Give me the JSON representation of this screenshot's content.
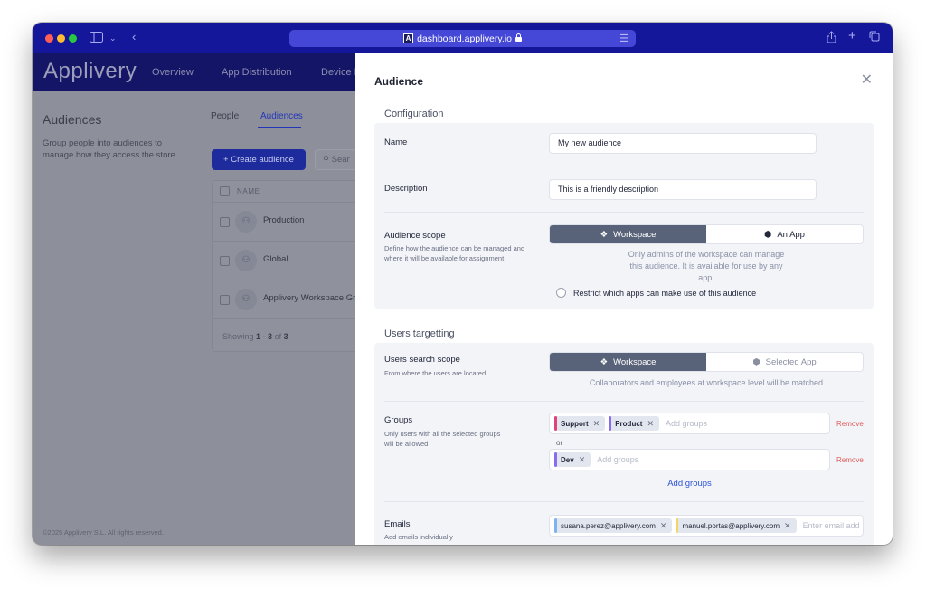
{
  "browser": {
    "url": "dashboard.applivery.io",
    "icons": [
      "sidebar-icon",
      "chevron-down-icon",
      "back-icon",
      "share-icon",
      "new-tab-icon",
      "tabs-overview-icon",
      "lock-icon",
      "reader-icon"
    ]
  },
  "appnav": {
    "brand": "Applivery",
    "links": [
      "Overview",
      "App Distribution",
      "Device M"
    ]
  },
  "page": {
    "title": "Audiences",
    "description": "Group people into audiences to manage how they access the store.",
    "tabs": [
      {
        "label": "People",
        "active": false
      },
      {
        "label": "Audiences",
        "active": true
      }
    ],
    "create_button": "+ Create audience",
    "search_placeholder": "Sear",
    "table": {
      "header": "NAME",
      "rows": [
        "Production",
        "Global",
        "Applivery Workspace Gro"
      ],
      "showing_prefix": "Showing ",
      "range_start": "1",
      "range_sep": " - ",
      "range_end": "3",
      "of": " of ",
      "total": "3"
    },
    "footer": "©2025 Applivery S.L. All rights reserved."
  },
  "panel": {
    "title": "Audience",
    "configuration": {
      "section_title": "Configuration",
      "name_label": "Name",
      "name_value": "My new audience",
      "description_label": "Description",
      "description_value": "This is a friendly description",
      "scope_label": "Audience scope",
      "scope_hint": "Define how the audience can be managed and where it will be available for assignment",
      "scope_options": [
        {
          "label": "Workspace",
          "active": true
        },
        {
          "label": "An App",
          "active": false
        }
      ],
      "scope_helper": "Only admins of the workspace can manage this audience. It is available for use by any app.",
      "restrict_label": "Restrict which apps can make use of this audience",
      "restrict_checked": false
    },
    "targeting": {
      "section_title": "Users targetting",
      "search_scope_label": "Users search scope",
      "search_scope_hint": "From where the users are located",
      "search_scope_options": [
        {
          "label": "Workspace",
          "active": true
        },
        {
          "label": "Selected App",
          "active": false
        }
      ],
      "search_scope_helper": "Collaborators and employees at workspace level will be matched",
      "groups_label": "Groups",
      "groups_hint": "Only users with all the selected groups will be allowed",
      "group_sets": [
        {
          "tags": [
            {
              "label": "Support",
              "color": "#e0437a"
            },
            {
              "label": "Product",
              "color": "#8a6cf0"
            }
          ],
          "placeholder": "Add groups",
          "remove": "Remove"
        },
        {
          "tags": [
            {
              "label": "Dev",
              "color": "#8a6cf0"
            }
          ],
          "placeholder": "Add groups",
          "remove": "Remove"
        }
      ],
      "or_label": "or",
      "add_groups": "Add groups",
      "emails_label": "Emails",
      "emails_hint": "Add emails individually",
      "emails": [
        {
          "label": "susana.perez@applivery.com",
          "color": "#7fb2f0"
        },
        {
          "label": "manuel.portas@applivery.com",
          "color": "#f2d46b"
        }
      ],
      "emails_placeholder": "Enter email add"
    }
  },
  "colors": {
    "toolbar": "#15179a",
    "accent": "#2c52d6",
    "segment_active": "#586278",
    "danger": "#e05a5a"
  }
}
